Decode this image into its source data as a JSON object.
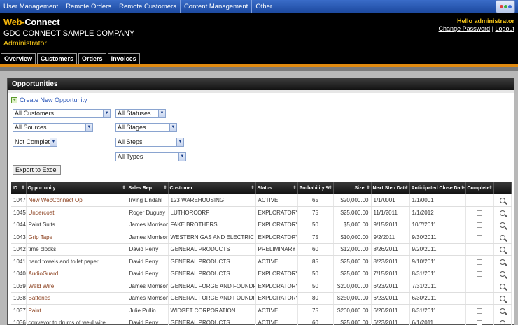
{
  "topnav": {
    "items": [
      "User Management",
      "Remote Orders",
      "Remote Customers",
      "Content Management",
      "Other"
    ],
    "logo_icon": "multicolor-app-icon"
  },
  "header": {
    "brand_web": "Web",
    "brand_dash": "-",
    "brand_connect": "Connect",
    "company": "GDC CONNECT SAMPLE COMPANY",
    "role": "Administrator",
    "greeting": "Hello administrator",
    "change_password": "Change Password",
    "separator": "|",
    "logout": "Logout"
  },
  "tabs": [
    "Overview",
    "Customers",
    "Orders",
    "Invoices"
  ],
  "panel": {
    "title": "Opportunities",
    "create_link": "Create New Opportunity",
    "export_label": "Export to Excel"
  },
  "filters": {
    "customers": "All Customers",
    "statuses": "All Statuses",
    "sources": "All Sources",
    "stages": "All Stages",
    "complete": "Not Complete",
    "steps": "All Steps",
    "types": "All Types"
  },
  "table": {
    "headers": [
      "ID",
      "Opportunity",
      "Sales Rep",
      "Customer",
      "Status",
      "Probability %",
      "Size",
      "Next Step Date",
      "Anticipated Close Date",
      "Complete"
    ],
    "rows": [
      {
        "id": "1047",
        "opportunity": "New WebConnect Op",
        "rep": "Irving Lindahl",
        "customer": "123 WAREHOUSING",
        "status": "ACTIVE",
        "prob": "65",
        "size": "$20,000.00",
        "next": "1/1/0001",
        "close": "1/1/0001",
        "link": true
      },
      {
        "id": "1045",
        "opportunity": "Undercoat",
        "rep": "Roger Duguay",
        "customer": "LUTHORCORP",
        "status": "EXPLORATORY",
        "prob": "75",
        "size": "$25,000.00",
        "next": "11/1/2011",
        "close": "1/1/2012",
        "link": true
      },
      {
        "id": "1044",
        "opportunity": "Paint Suits",
        "rep": "James Morrison",
        "customer": "FAKE BROTHERS",
        "status": "EXPLORATORY",
        "prob": "50",
        "size": "$5,000.00",
        "next": "9/15/2011",
        "close": "10/7/2011",
        "link": false
      },
      {
        "id": "1043",
        "opportunity": "Grip Tape",
        "rep": "James Morrison",
        "customer": "WESTERN GAS AND ELECTRIC",
        "status": "EXPLORATORY",
        "prob": "75",
        "size": "$10,000.00",
        "next": "9/2/2011",
        "close": "9/30/2011",
        "link": true
      },
      {
        "id": "1042",
        "opportunity": "time clocks",
        "rep": "David Perry",
        "customer": "GENERAL PRODUCTS",
        "status": "PRELIMINARY",
        "prob": "60",
        "size": "$12,000.00",
        "next": "8/26/2011",
        "close": "9/20/2011",
        "link": false
      },
      {
        "id": "1041",
        "opportunity": "hand towels and toilet paper",
        "rep": "David Perry",
        "customer": "GENERAL PRODUCTS",
        "status": "ACTIVE",
        "prob": "85",
        "size": "$25,000.00",
        "next": "8/23/2011",
        "close": "9/10/2011",
        "link": false
      },
      {
        "id": "1040",
        "opportunity": "AudioGuard",
        "rep": "David Perry",
        "customer": "GENERAL PRODUCTS",
        "status": "EXPLORATORY",
        "prob": "50",
        "size": "$25,000.00",
        "next": "7/15/2011",
        "close": "8/31/2011",
        "link": true
      },
      {
        "id": "1039",
        "opportunity": "Weld Wire",
        "rep": "James Morrison",
        "customer": "GENERAL FORGE AND FOUNDRY",
        "status": "EXPLORATORY",
        "prob": "50",
        "size": "$200,000.00",
        "next": "6/23/2011",
        "close": "7/31/2011",
        "link": true
      },
      {
        "id": "1038",
        "opportunity": "Batteries",
        "rep": "James Morrison",
        "customer": "GENERAL FORGE AND FOUNDRY",
        "status": "EXPLORATORY",
        "prob": "80",
        "size": "$250,000.00",
        "next": "6/23/2011",
        "close": "6/30/2011",
        "link": true
      },
      {
        "id": "1037",
        "opportunity": "Paint",
        "rep": "Julie Pullin",
        "customer": "WIDGET CORPORATION",
        "status": "ACTIVE",
        "prob": "75",
        "size": "$200,000.00",
        "next": "6/20/2011",
        "close": "8/31/2011",
        "link": true
      },
      {
        "id": "1036",
        "opportunity": "conveyor to drums of weld wire",
        "rep": "David Perry",
        "customer": "GENERAL PRODUCTS",
        "status": "ACTIVE",
        "prob": "60",
        "size": "$25,000.00",
        "next": "6/23/2011",
        "close": "6/1/2011",
        "link": false
      }
    ]
  },
  "colors": {
    "brand_orange": "#f5b50a",
    "nav_blue": "#1d4aa0",
    "link_red": "#8a3d1a",
    "accent_bar": "#e08a10"
  }
}
